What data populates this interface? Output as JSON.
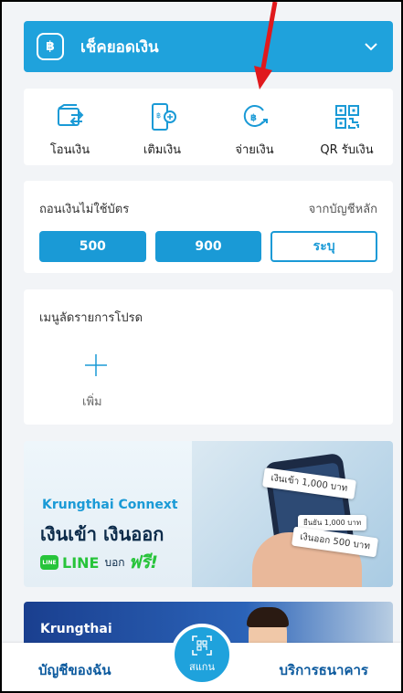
{
  "balance": {
    "label": "เช็คยอดเงิน",
    "badge": "฿"
  },
  "quick_actions": [
    {
      "label": "โอนเงิน",
      "icon": "transfer-icon"
    },
    {
      "label": "เติมเงิน",
      "icon": "topup-icon"
    },
    {
      "label": "จ่ายเงิน",
      "icon": "pay-icon"
    },
    {
      "label": "QR รับเงิน",
      "icon": "qr-receive-icon"
    }
  ],
  "cardless_withdraw": {
    "title": "ถอนเงินไม่ใช้บัตร",
    "source": "จากบัญชีหลัก",
    "amounts": [
      "500",
      "900"
    ],
    "custom_label": "ระบุ"
  },
  "shortcut_menu": {
    "title": "เมนูลัดรายการโปรด",
    "add_label": "เพิ่ม"
  },
  "banner": {
    "brand": "Krungthai Connext",
    "headline": "เงินเข้า เงินออก",
    "line_word": "LINE",
    "line_logo": "LINE",
    "line_small": "บอก",
    "line_free": "ฟรี!",
    "tag_in": "เงินเข้า 1,000 บาท",
    "tag_mid": "ยืนยัน 1,000 บาท",
    "tag_out": "เงินออก 500 บาท"
  },
  "banner2": {
    "text": "Krungthai"
  },
  "bottom_nav": {
    "left": "บัญชีของฉัน",
    "scan": "สแกน",
    "right": "บริการธนาคาร"
  },
  "colors": {
    "accent": "#1fa2dc",
    "nav_text": "#0c5a9e",
    "line_green": "#27c43a",
    "arrow": "#e0191d"
  }
}
